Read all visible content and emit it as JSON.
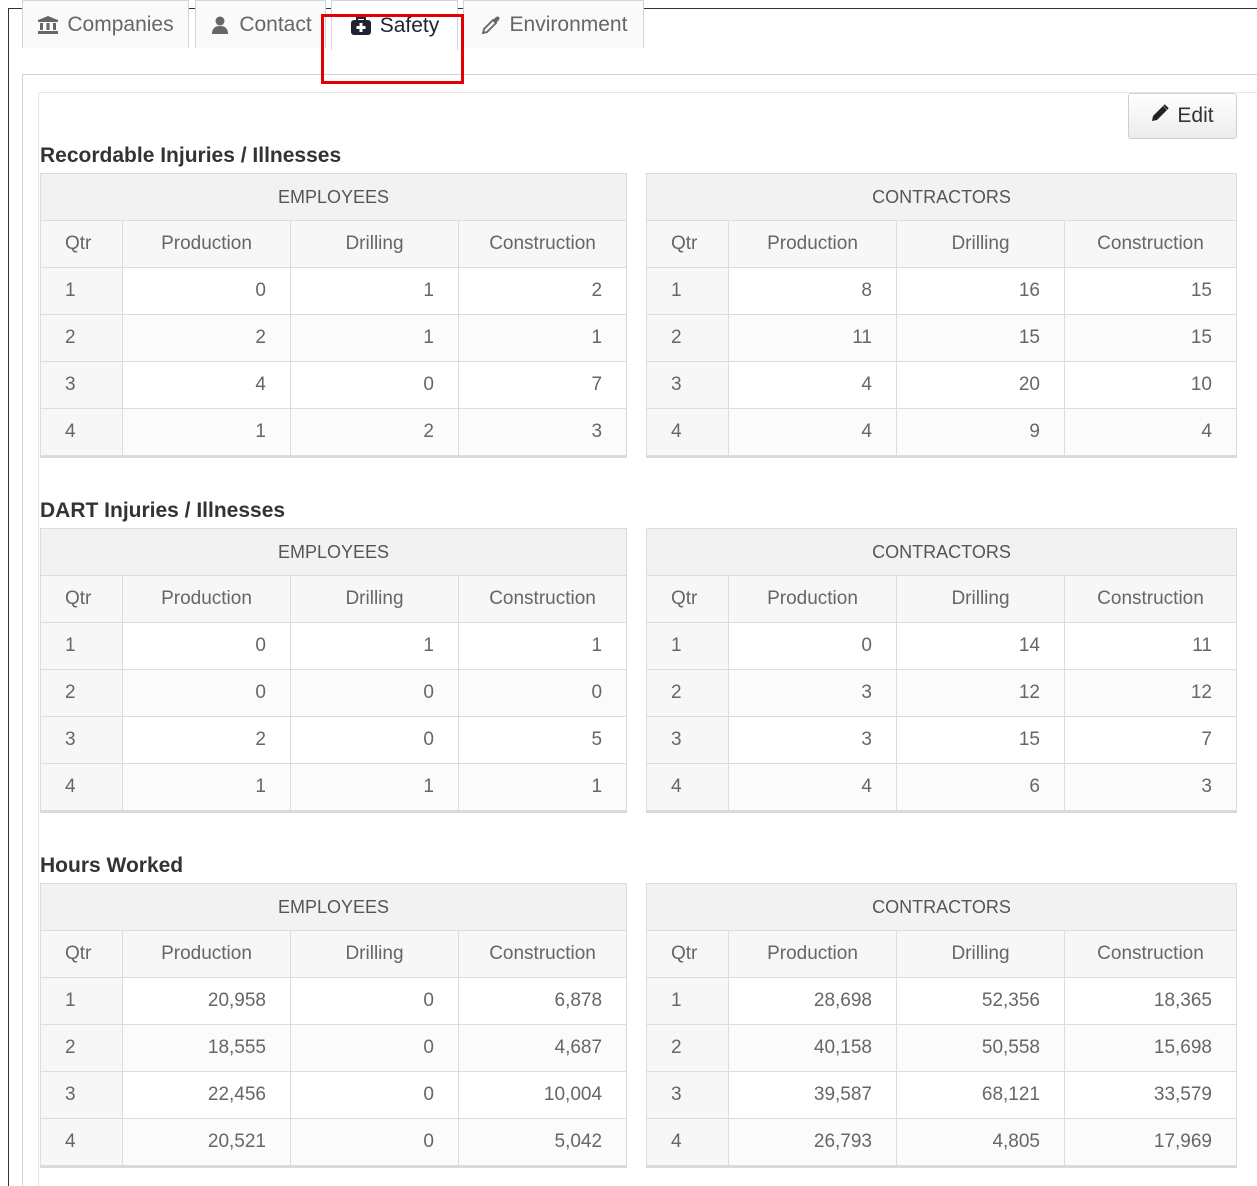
{
  "tabs": [
    {
      "label": "Companies",
      "icon": "bank-icon"
    },
    {
      "label": "Contact",
      "icon": "user-icon"
    },
    {
      "label": "Safety",
      "icon": "medkit-icon"
    },
    {
      "label": "Environment",
      "icon": "eyedropper-icon"
    }
  ],
  "active_tab": "Safety",
  "edit_label": "Edit",
  "columns": {
    "employees": "EMPLOYEES",
    "contractors": "CONTRACTORS",
    "qtr": "Qtr",
    "production": "Production",
    "drilling": "Drilling",
    "construction": "Construction"
  },
  "sections": [
    {
      "title": "Recordable Injuries / Illnesses",
      "employees": [
        [
          "1",
          "0",
          "1",
          "2"
        ],
        [
          "2",
          "2",
          "1",
          "1"
        ],
        [
          "3",
          "4",
          "0",
          "7"
        ],
        [
          "4",
          "1",
          "2",
          "3"
        ]
      ],
      "contractors": [
        [
          "1",
          "8",
          "16",
          "15"
        ],
        [
          "2",
          "11",
          "15",
          "15"
        ],
        [
          "3",
          "4",
          "20",
          "10"
        ],
        [
          "4",
          "4",
          "9",
          "4"
        ]
      ]
    },
    {
      "title": "DART Injuries / Illnesses",
      "employees": [
        [
          "1",
          "0",
          "1",
          "1"
        ],
        [
          "2",
          "0",
          "0",
          "0"
        ],
        [
          "3",
          "2",
          "0",
          "5"
        ],
        [
          "4",
          "1",
          "1",
          "1"
        ]
      ],
      "contractors": [
        [
          "1",
          "0",
          "14",
          "11"
        ],
        [
          "2",
          "3",
          "12",
          "12"
        ],
        [
          "3",
          "3",
          "15",
          "7"
        ],
        [
          "4",
          "4",
          "6",
          "3"
        ]
      ]
    },
    {
      "title": "Hours Worked",
      "employees": [
        [
          "1",
          "20,958",
          "0",
          "6,878"
        ],
        [
          "2",
          "18,555",
          "0",
          "4,687"
        ],
        [
          "3",
          "22,456",
          "0",
          "10,004"
        ],
        [
          "4",
          "20,521",
          "0",
          "5,042"
        ]
      ],
      "contractors": [
        [
          "1",
          "28,698",
          "52,356",
          "18,365"
        ],
        [
          "2",
          "40,158",
          "50,558",
          "15,698"
        ],
        [
          "3",
          "39,587",
          "68,121",
          "33,579"
        ],
        [
          "4",
          "26,793",
          "4,805",
          "17,969"
        ]
      ]
    }
  ],
  "colors": {
    "highlight": "#e30000",
    "tab_border": "#ccd6e0"
  }
}
